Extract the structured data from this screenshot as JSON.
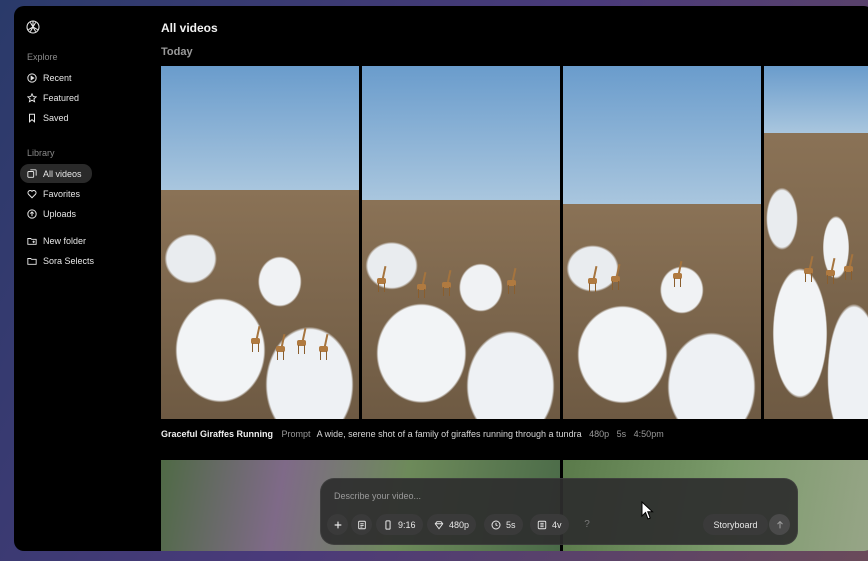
{
  "sidebar": {
    "explore_label": "Explore",
    "explore_items": [
      {
        "label": "Recent",
        "icon": "play-circle-icon"
      },
      {
        "label": "Featured",
        "icon": "star-icon"
      },
      {
        "label": "Saved",
        "icon": "bookmark-icon"
      }
    ],
    "library_label": "Library",
    "library_items": [
      {
        "label": "All videos",
        "icon": "videos-icon",
        "active": true
      },
      {
        "label": "Favorites",
        "icon": "heart-icon"
      },
      {
        "label": "Uploads",
        "icon": "upload-icon"
      }
    ],
    "folder_items": [
      {
        "label": "New folder",
        "icon": "folder-plus-icon"
      },
      {
        "label": "Sora Selects",
        "icon": "folder-icon"
      }
    ]
  },
  "main": {
    "title": "All videos",
    "group_label": "Today",
    "video": {
      "title": "Graceful Giraffes Running",
      "prompt_label": "Prompt",
      "prompt": "A wide, serene shot of a family of giraffes running through a tundra",
      "resolution": "480p",
      "duration": "5s",
      "time": "4:50pm"
    }
  },
  "composer": {
    "placeholder": "Describe your video...",
    "add_icon": "plus-icon",
    "preset_icon": "preset-icon",
    "aspect": "9:16",
    "resolution": "480p",
    "duration": "5s",
    "variations": "4v",
    "help": "?",
    "storyboard": "Storyboard",
    "send_icon": "arrow-up-icon"
  },
  "colors": {
    "background": "#000000",
    "sidebar_active": "#2a2a2a",
    "composer_bg": "#2e2e2e",
    "chip_bg": "#3a3a3a"
  }
}
